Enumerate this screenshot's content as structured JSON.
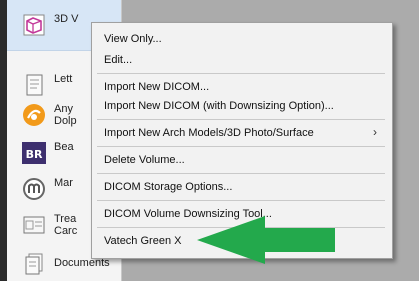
{
  "sidebar": {
    "items": [
      {
        "label": "3D V",
        "icon": "3d-cube-icon"
      },
      {
        "label": "Lett",
        "icon": "letter-icon"
      },
      {
        "label": "Any\nDolp",
        "icon": "anydolph-icon"
      },
      {
        "label": "Bea",
        "icon": "br-icon"
      },
      {
        "label": "Mar",
        "icon": "m-logo-icon"
      },
      {
        "label": "Trea\nCarc",
        "icon": "treatment-card-icon"
      },
      {
        "label": "Documents",
        "icon": "documents-icon"
      }
    ]
  },
  "menu": {
    "items": [
      {
        "label": "View Only..."
      },
      {
        "label": "Edit..."
      },
      {
        "label": "Import New DICOM..."
      },
      {
        "label": "Import New DICOM (with Downsizing Option)..."
      },
      {
        "label": "Import New Arch Models/3D Photo/Surface",
        "submenu_glyph": "›"
      },
      {
        "label": "Delete Volume..."
      },
      {
        "label": "DICOM Storage Options..."
      },
      {
        "label": "DICOM Volume Downsizing Tool..."
      },
      {
        "label": "Vatech Green X"
      }
    ]
  },
  "colors": {
    "arrow": "#23a94c",
    "menu_bg": "#f2f2f2",
    "sidebar_highlight": "#d7e6f6",
    "desktop": "#ababab"
  }
}
